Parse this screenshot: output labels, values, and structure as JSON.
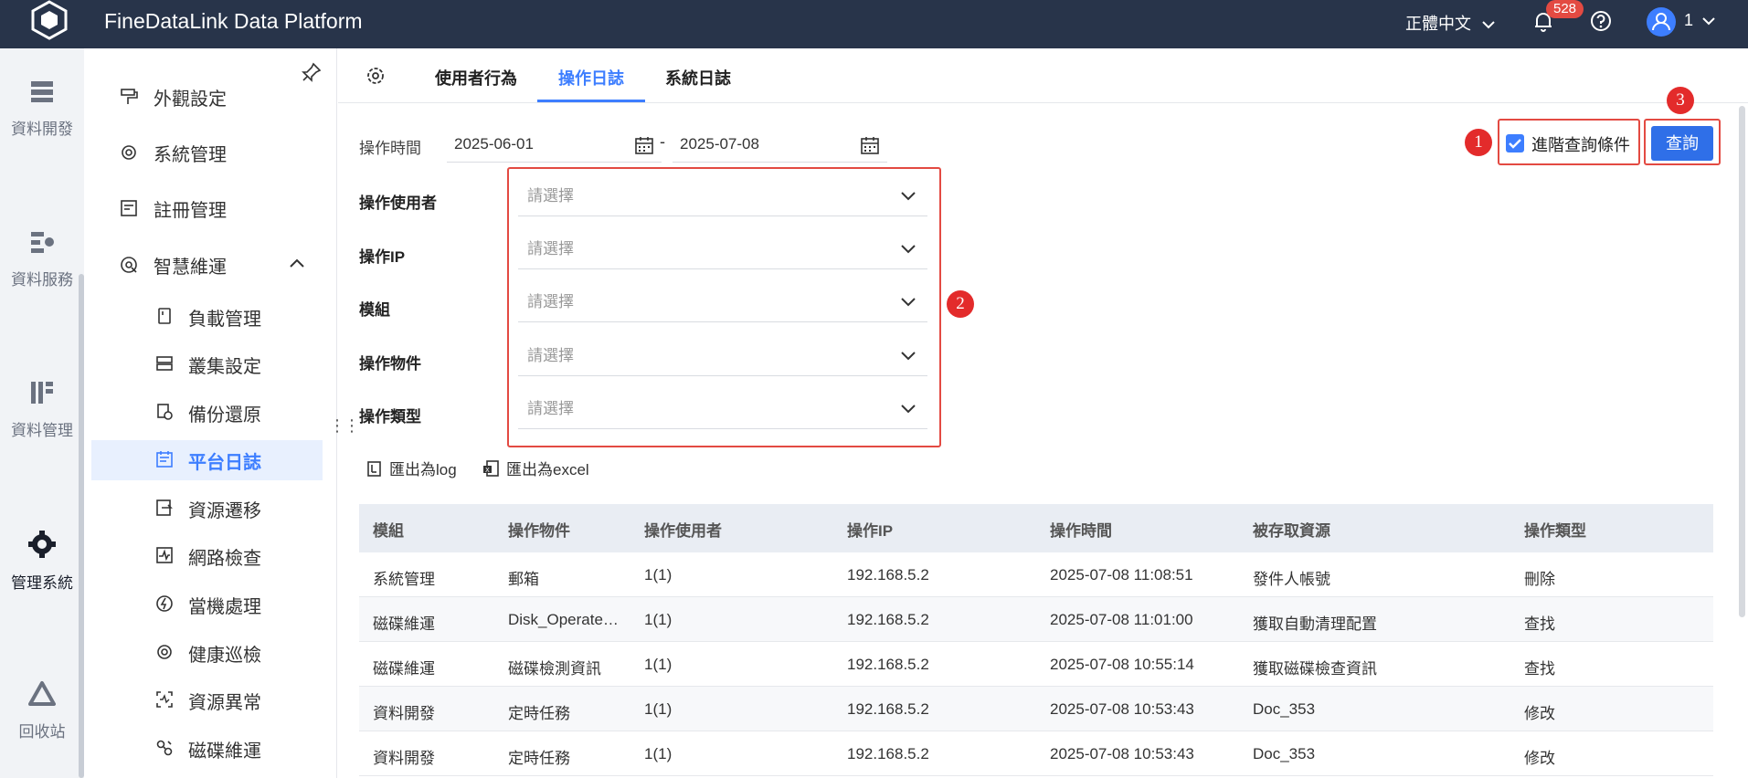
{
  "header": {
    "app_title": "FineDataLink Data Platform",
    "language": "正體中文",
    "notification_count": "528",
    "user": "1"
  },
  "rail": {
    "items": [
      {
        "label": "資料開發",
        "icon": "data-dev-icon"
      },
      {
        "label": "資料服務",
        "icon": "data-service-icon"
      },
      {
        "label": "資料管理",
        "icon": "data-manage-icon"
      },
      {
        "label": "管理系統",
        "icon": "gear-icon",
        "active": true
      },
      {
        "label": "回收站",
        "icon": "recycle-icon"
      }
    ]
  },
  "subnav": {
    "items": [
      {
        "label": "外觀設定",
        "icon": "paint-roller-icon"
      },
      {
        "label": "系統管理",
        "icon": "gear-icon"
      },
      {
        "label": "註冊管理",
        "icon": "register-icon"
      },
      {
        "label": "智慧維運",
        "icon": "smart-ops-icon",
        "expanded": true
      },
      {
        "label": "負載管理",
        "icon": "load-icon"
      },
      {
        "label": "叢集設定",
        "icon": "cluster-icon"
      },
      {
        "label": "備份還原",
        "icon": "backup-icon"
      },
      {
        "label": "平台日誌",
        "icon": "log-icon",
        "active": true
      },
      {
        "label": "資源遷移",
        "icon": "migrate-icon"
      },
      {
        "label": "網路檢查",
        "icon": "network-icon"
      },
      {
        "label": "當機處理",
        "icon": "crash-icon"
      },
      {
        "label": "健康巡檢",
        "icon": "health-icon"
      },
      {
        "label": "資源異常",
        "icon": "anomaly-icon"
      },
      {
        "label": "磁碟維運",
        "icon": "disk-icon"
      }
    ]
  },
  "tabs": [
    {
      "label": "使用者行為"
    },
    {
      "label": "操作日誌",
      "active": true
    },
    {
      "label": "系統日誌"
    }
  ],
  "filters": {
    "time_label": "操作時間",
    "date_start": "2025-06-01",
    "date_separator": "-",
    "date_end": "2025-07-08",
    "fields": [
      {
        "label": "操作使用者",
        "placeholder": "請選擇"
      },
      {
        "label": "操作IP",
        "placeholder": "請選擇"
      },
      {
        "label": "模組",
        "placeholder": "請選擇"
      },
      {
        "label": "操作物件",
        "placeholder": "請選擇"
      },
      {
        "label": "操作類型",
        "placeholder": "請選擇"
      }
    ],
    "advanced_label": "進階查詢條件",
    "advanced_checked": true,
    "query_button": "查詢"
  },
  "annotations": [
    "1",
    "2",
    "3"
  ],
  "export": {
    "log_label": "匯出為log",
    "excel_label": "匯出為excel"
  },
  "table": {
    "columns": [
      "模組",
      "操作物件",
      "操作使用者",
      "操作IP",
      "操作時間",
      "被存取資源",
      "操作類型"
    ],
    "rows": [
      [
        "系統管理",
        "郵箱",
        "1(1)",
        "192.168.5.2",
        "2025-07-08 11:08:51",
        "發件人帳號",
        "刪除"
      ],
      [
        "磁碟維運",
        "Disk_Operate…",
        "1(1)",
        "192.168.5.2",
        "2025-07-08 11:01:00",
        "獲取自動清理配置",
        "查找"
      ],
      [
        "磁碟維運",
        "磁碟檢測資訊",
        "1(1)",
        "192.168.5.2",
        "2025-07-08 10:55:14",
        "獲取磁碟檢查資訊",
        "查找"
      ],
      [
        "資料開發",
        "定時任務",
        "1(1)",
        "192.168.5.2",
        "2025-07-08 10:53:43",
        "Doc_353",
        "修改"
      ],
      [
        "資料開發",
        "定時任務",
        "1(1)",
        "192.168.5.2",
        "2025-07-08 10:53:43",
        "Doc_353",
        "修改"
      ]
    ]
  },
  "colors": {
    "topbar": "#28344a",
    "accent": "#3d7eff",
    "annotation_red": "#e32b2b"
  }
}
